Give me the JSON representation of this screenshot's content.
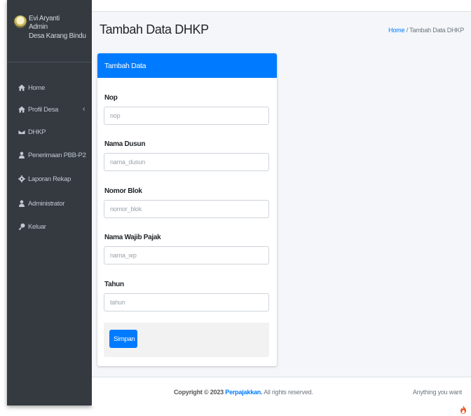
{
  "user": {
    "name": "Evi Aryanti",
    "role": "Admin",
    "village": "Desa Karang Bindu"
  },
  "sidebar": {
    "items": [
      {
        "label": "Home",
        "icon": "home-icon"
      },
      {
        "label": "Profil Desa",
        "icon": "home-icon",
        "chevron": "‹"
      },
      {
        "label": "DHKP",
        "icon": "envelope-icon"
      },
      {
        "label": "Penerimaan PBB-P2",
        "icon": "user-icon"
      },
      {
        "label": "Laporan Rekap",
        "icon": "gear-icon"
      },
      {
        "label": "Administrator",
        "icon": "user-icon"
      },
      {
        "label": "Keluar",
        "icon": "key-icon"
      }
    ]
  },
  "header": {
    "title": "Tambah Data DHKP",
    "breadcrumb": {
      "home": "Home",
      "separator": "/",
      "current": "Tambah Data DHKP"
    }
  },
  "form": {
    "card_title": "Tambah Data",
    "fields": [
      {
        "label": "Nop",
        "placeholder": "nop"
      },
      {
        "label": "Nama Dusun",
        "placeholder": "nama_dusun"
      },
      {
        "label": "Nomor Blok",
        "placeholder": "nomor_blok"
      },
      {
        "label": "Nama Wajib Pajak",
        "placeholder": "nama_wp"
      },
      {
        "label": "Tahun",
        "placeholder": "tahun"
      }
    ],
    "submit_label": "Simpan"
  },
  "footer": {
    "copyright_prefix": "Copyright © 2023",
    "brand": "Perpajakkan.",
    "copyright_suffix": "All rights reserved.",
    "right_text": "Anything you want"
  },
  "colors": {
    "primary": "#007bff",
    "sidebar_bg": "#343a40",
    "content_bg": "#f4f6f9"
  }
}
